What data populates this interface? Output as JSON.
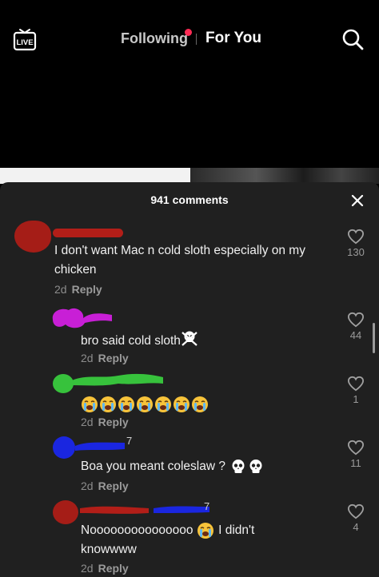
{
  "header": {
    "live_label": "LIVE",
    "tab_following": "Following",
    "tab_for_you": "For You"
  },
  "sheet": {
    "title": "941 comments"
  },
  "comments": [
    {
      "text": "I don't want Mac n cold sloth especially on my chicken",
      "time": "2d",
      "reply": "Reply",
      "likes": "130"
    },
    {
      "text": "bro said cold sloth",
      "time": "2d",
      "reply": "Reply",
      "likes": "44",
      "emoji": "skull-crossbones"
    },
    {
      "text": "",
      "time": "2d",
      "reply": "Reply",
      "likes": "1",
      "emoji": "loudly-crying-face x7"
    },
    {
      "text": "Boa you meant coleslaw ?",
      "time": "2d",
      "reply": "Reply",
      "likes": "11",
      "emoji": "skull x2",
      "username_suffix": "7"
    },
    {
      "text_a": "Nooooooooooooooo",
      "text_b": "I didn't",
      "text_c": "knowwww",
      "time": "2d",
      "reply": "Reply",
      "likes": "4",
      "emoji": "loudly-crying-face",
      "username_suffix": "7"
    }
  ],
  "colors": {
    "sheet_bg": "#202020",
    "accent_dot": "#ff2b55",
    "scribble_red": "#b0201a",
    "scribble_magenta": "#c81fd6",
    "scribble_green": "#37c23c",
    "scribble_blue": "#1a26e0"
  }
}
